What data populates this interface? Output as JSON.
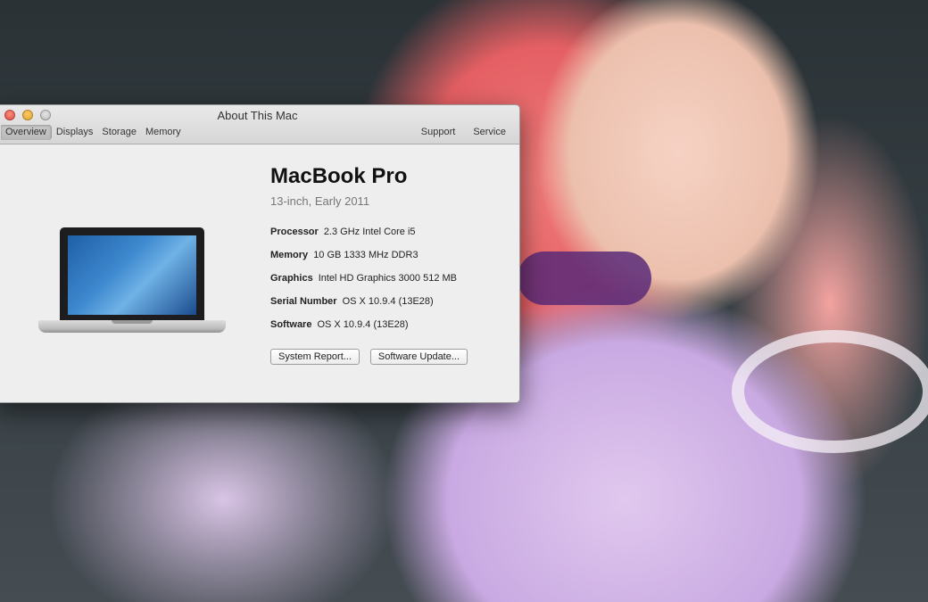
{
  "window": {
    "title": "About This Mac",
    "tabs_left": [
      "Overview",
      "Displays",
      "Storage",
      "Memory"
    ],
    "tabs_right": [
      "Support",
      "Service"
    ],
    "active_tab": "Overview"
  },
  "model": {
    "name": "MacBook Pro",
    "subtitle": "13-inch, Early 2011"
  },
  "specs": [
    {
      "label": "Processor",
      "value": "2.3 GHz Intel Core i5"
    },
    {
      "label": "Memory",
      "value": "10 GB 1333 MHz DDR3"
    },
    {
      "label": "Graphics",
      "value": "Intel HD Graphics 3000 512 MB"
    },
    {
      "label": "Serial Number",
      "value": "OS X 10.9.4 (13E28)"
    },
    {
      "label": "Software",
      "value": "OS X 10.9.4 (13E28)"
    }
  ],
  "buttons": {
    "system_report": "System Report...",
    "software_update": "Software Update..."
  },
  "icons": {
    "close": "close-icon",
    "minimize": "minimize-icon",
    "zoom": "zoom-icon",
    "laptop": "macbook-pro-image"
  }
}
